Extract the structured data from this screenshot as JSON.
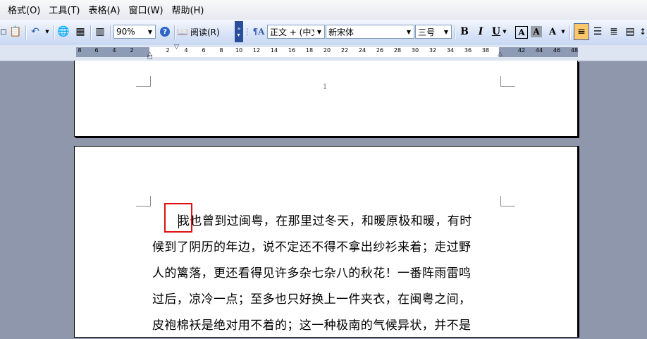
{
  "menubar": {
    "items": [
      "格式(O)",
      "工具(T)",
      "表格(A)",
      "窗口(W)",
      "帮助(H)"
    ]
  },
  "toolbar": {
    "zoom": "90%",
    "read_label": "阅读(R)",
    "style": "正文 + (中文",
    "font": "新宋体",
    "size": "三号",
    "bold": "B",
    "italic": "I",
    "underline": "U",
    "char_border": "A",
    "char_shade": "A",
    "char_scale": "A"
  },
  "ruler": {
    "ticks": [
      "8",
      "6",
      "4",
      "2",
      "2",
      "4",
      "6",
      "8",
      "10",
      "12",
      "14",
      "16",
      "18",
      "20",
      "22",
      "24",
      "26",
      "28",
      "30",
      "32",
      "34",
      "36",
      "38",
      "42",
      "44",
      "46",
      "48"
    ]
  },
  "document": {
    "page1_number": "1",
    "paragraph_lines": [
      "我也曾到过闽粤，在那里过冬天，和暖原极和暖，有时",
      "候到了阴历的年边，说不定还不得不拿出纱衫来着；走过野",
      "人的篱落，更还看得见许多杂七杂八的秋花！一番阵雨雷鸣",
      "过后，凉冷一点；至多也只好换上一件夹衣，在闽粤之间，",
      "皮袍棉袄是绝对用不着的；这一种极南的气候异状，并不是"
    ]
  },
  "colors": {
    "highlight": "#e01010",
    "workspace": "#8e97ab",
    "active_button": "#ffc76b"
  }
}
